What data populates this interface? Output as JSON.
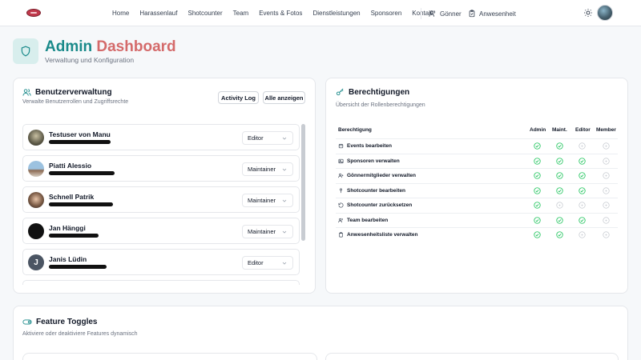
{
  "nav": {
    "links": [
      "Home",
      "Harassenlauf",
      "Shotcounter",
      "Team",
      "Events & Fotos",
      "Dienstleistungen",
      "Sponsoren",
      "Kontakt"
    ],
    "goenner": "Gönner",
    "anwesenheit": "Anwesenheit"
  },
  "header": {
    "title_part1": "Admin",
    "title_part2": "Dashboard",
    "subtitle": "Verwaltung und Konfiguration"
  },
  "users_card": {
    "title": "Benutzerverwaltung",
    "subtitle": "Verwalte Benutzerrollen und Zugriffsrechte",
    "activity_log_label": "Activity Log",
    "show_all_label": "Alle anzeigen",
    "users": [
      {
        "name": "Testuser von Manu",
        "role": "Editor"
      },
      {
        "name": "Piatti Alessio",
        "role": "Maintainer"
      },
      {
        "name": "Schnell Patrik",
        "role": "Maintainer"
      },
      {
        "name": "Jan Hänggi",
        "role": "Maintainer"
      },
      {
        "name": "Janis Lüdin",
        "role": "Editor",
        "initial": "J"
      }
    ]
  },
  "permissions_card": {
    "title": "Berechtigungen",
    "subtitle": "Übersicht der Rollenberechtigungen",
    "columns": [
      "Berechtigung",
      "Admin",
      "Maint.",
      "Editor",
      "Member"
    ],
    "rows": [
      {
        "label": "Events bearbeiten",
        "icon": "calendar-icon",
        "admin": true,
        "maint": true,
        "editor": false,
        "member": false
      },
      {
        "label": "Sponsoren verwalten",
        "icon": "image-icon",
        "admin": true,
        "maint": true,
        "editor": true,
        "member": false
      },
      {
        "label": "Gönnermitglieder verwalten",
        "icon": "user-plus-icon",
        "admin": true,
        "maint": true,
        "editor": true,
        "member": false
      },
      {
        "label": "Shotcounter bearbeiten",
        "icon": "pin-icon",
        "admin": true,
        "maint": true,
        "editor": true,
        "member": false
      },
      {
        "label": "Shotcounter zurücksetzen",
        "icon": "reset-icon",
        "admin": true,
        "maint": false,
        "editor": false,
        "member": false
      },
      {
        "label": "Team bearbeiten",
        "icon": "users-icon",
        "admin": true,
        "maint": true,
        "editor": true,
        "member": false
      },
      {
        "label": "Anwesenheitsliste verwalten",
        "icon": "clipboard-icon",
        "admin": true,
        "maint": true,
        "editor": false,
        "member": false
      }
    ]
  },
  "features_card": {
    "title": "Feature Toggles",
    "subtitle": "Aktiviere oder deaktiviere Features dynamisch"
  },
  "colors": {
    "brand_teal": "#1a8a8a",
    "brand_coral": "#d46a6a",
    "check_green": "#22c55e",
    "check_gray": "#c7cbd1"
  }
}
